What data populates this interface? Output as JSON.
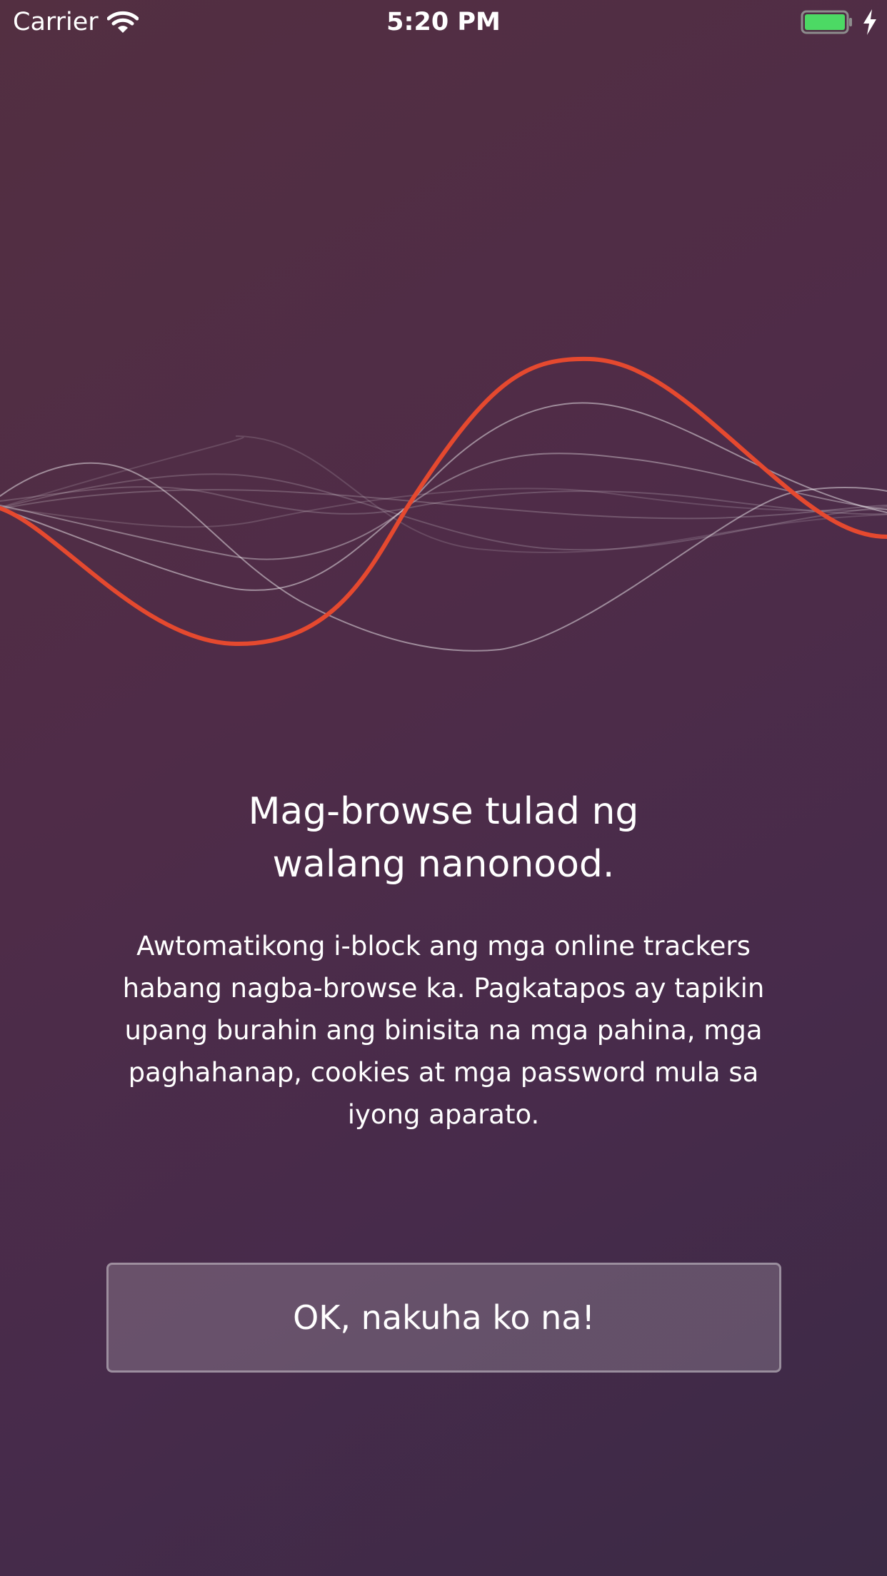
{
  "status_bar": {
    "carrier": "Carrier",
    "time": "5:20 PM",
    "battery_color": "#4cd964"
  },
  "onboarding": {
    "title": "Mag-browse tulad ng\nwalang nanonood.",
    "description": "Awtomatikong i-block ang mga online trackers habang nagba-browse ka. Pagkatapos ay tapikin upang burahin ang binisita na mga pahina, mga paghahanap, cookies at mga password mula sa iyong aparato.",
    "button_label": "OK, nakuha ko na!"
  },
  "colors": {
    "accent_wave": "#e5492f",
    "background_top": "#532f41",
    "background_bottom": "#3b2a45"
  }
}
